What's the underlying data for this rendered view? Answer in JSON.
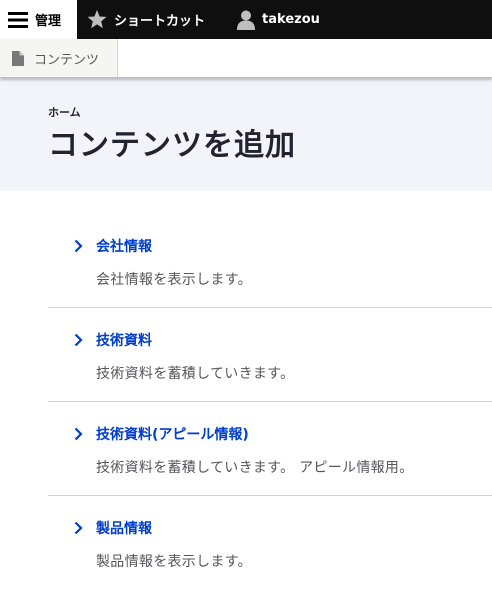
{
  "toolbar": {
    "manage_label": "管理",
    "shortcuts_label": "ショートカット",
    "user_label": "takezou"
  },
  "tray": {
    "content_label": "コンテンツ"
  },
  "header": {
    "breadcrumb": "ホーム",
    "title": "コンテンツを追加"
  },
  "content_types": [
    {
      "label": "会社情報",
      "description": "会社情報を表示します。"
    },
    {
      "label": "技術資料",
      "description": "技術資料を蓄積していきます。"
    },
    {
      "label": "技術資料(アピール情報)",
      "description": "技術資料を蓄積していきます。 アピール情報用。"
    },
    {
      "label": "製品情報",
      "description": "製品情報を表示します。"
    }
  ],
  "colors": {
    "toolbar_bg": "#0f0f0f",
    "header_bg": "#f3f4f9",
    "link": "#003ecc"
  }
}
